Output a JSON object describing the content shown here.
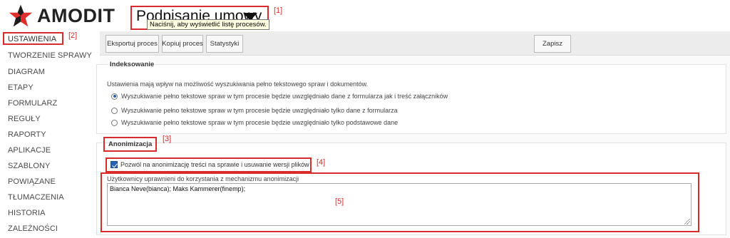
{
  "brand": {
    "logo_text": "AMODIT"
  },
  "process": {
    "title": "Podpisanie umowy",
    "tooltip": "Naciśnij, aby wyświetlić listę procesów."
  },
  "callouts": {
    "c1": "[1]",
    "c2": "[2]",
    "c3": "[3]",
    "c4": "[4]",
    "c5": "[5]"
  },
  "sidebar": {
    "items": [
      "USTAWIENIA",
      "TWORZENIE SPRAWY",
      "DIAGRAM",
      "ETAPY",
      "FORMULARZ",
      "REGUŁY",
      "RAPORTY",
      "APLIKACJE",
      "SZABLONY",
      "POWIĄZANE",
      "TŁUMACZENIA",
      "HISTORIA",
      "ZALEŻNOŚCI"
    ],
    "active": "USTAWIENIA"
  },
  "toolbar": {
    "export_label": "Eksportuj proces",
    "copy_label": "Kopiuj proces",
    "stats_label": "Statystyki",
    "save_label": "Zapisz"
  },
  "indexing": {
    "title": "Indeksowanie",
    "description": "Ustawienia mają wpływ na możliwość wyszukiwania pełno tekstowego spraw i dokumentów.",
    "options": [
      "Wyszukiwanie pełno tekstowe spraw w tym procesie będzie uwzględniało dane z formularza jak i treść załączników",
      "Wyszukiwanie pełno tekstowe spraw w tym procesie będzie uwzględniało tylko dane z formularza",
      "Wyszukiwanie pełno tekstowe spraw w tym procesie będzie uwzględniało tylko podstawowe dane"
    ],
    "selected_index": 0
  },
  "anonymization": {
    "title": "Anonimizacja",
    "checkbox_label": "Pozwól na anonimizację treści na sprawie i usuwanie wersji plików",
    "checkbox_checked": true,
    "users_label": "Użytkownicy uprawnieni do korzystania z mechanizmu anonimizacji",
    "users_value": "Bianca Neve(bianca); Maks Kammerer(finemp);"
  },
  "colors": {
    "highlight": "#d92b2b",
    "logo_red": "#e0302d",
    "checkbox_blue": "#2463b6",
    "tooltip_bg": "#ffffe1"
  }
}
